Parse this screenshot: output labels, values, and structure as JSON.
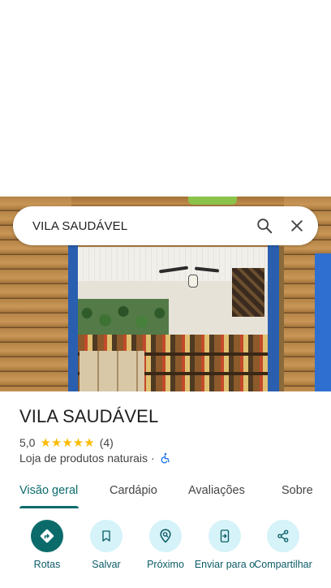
{
  "search": {
    "query": "VILA SAUDÁVEL"
  },
  "place": {
    "title": "VILA SAUDÁVEL",
    "rating": "5,0",
    "stars": "★★★★★",
    "review_count": "(4)",
    "category": "Loja de produtos naturais",
    "separator": "·"
  },
  "tabs": [
    {
      "label": "Visão geral"
    },
    {
      "label": "Cardápio"
    },
    {
      "label": "Avaliações"
    },
    {
      "label": "Sobre"
    }
  ],
  "actions": [
    {
      "label": "Rotas"
    },
    {
      "label": "Salvar"
    },
    {
      "label": "Próximo"
    },
    {
      "label": "Enviar para o"
    },
    {
      "label": "Compartilhar"
    }
  ],
  "colors": {
    "accent": "#0b6b6b",
    "action_bg": "#d5f3f8",
    "star": "#fbbc04",
    "accessibility": "#1a73e8"
  }
}
